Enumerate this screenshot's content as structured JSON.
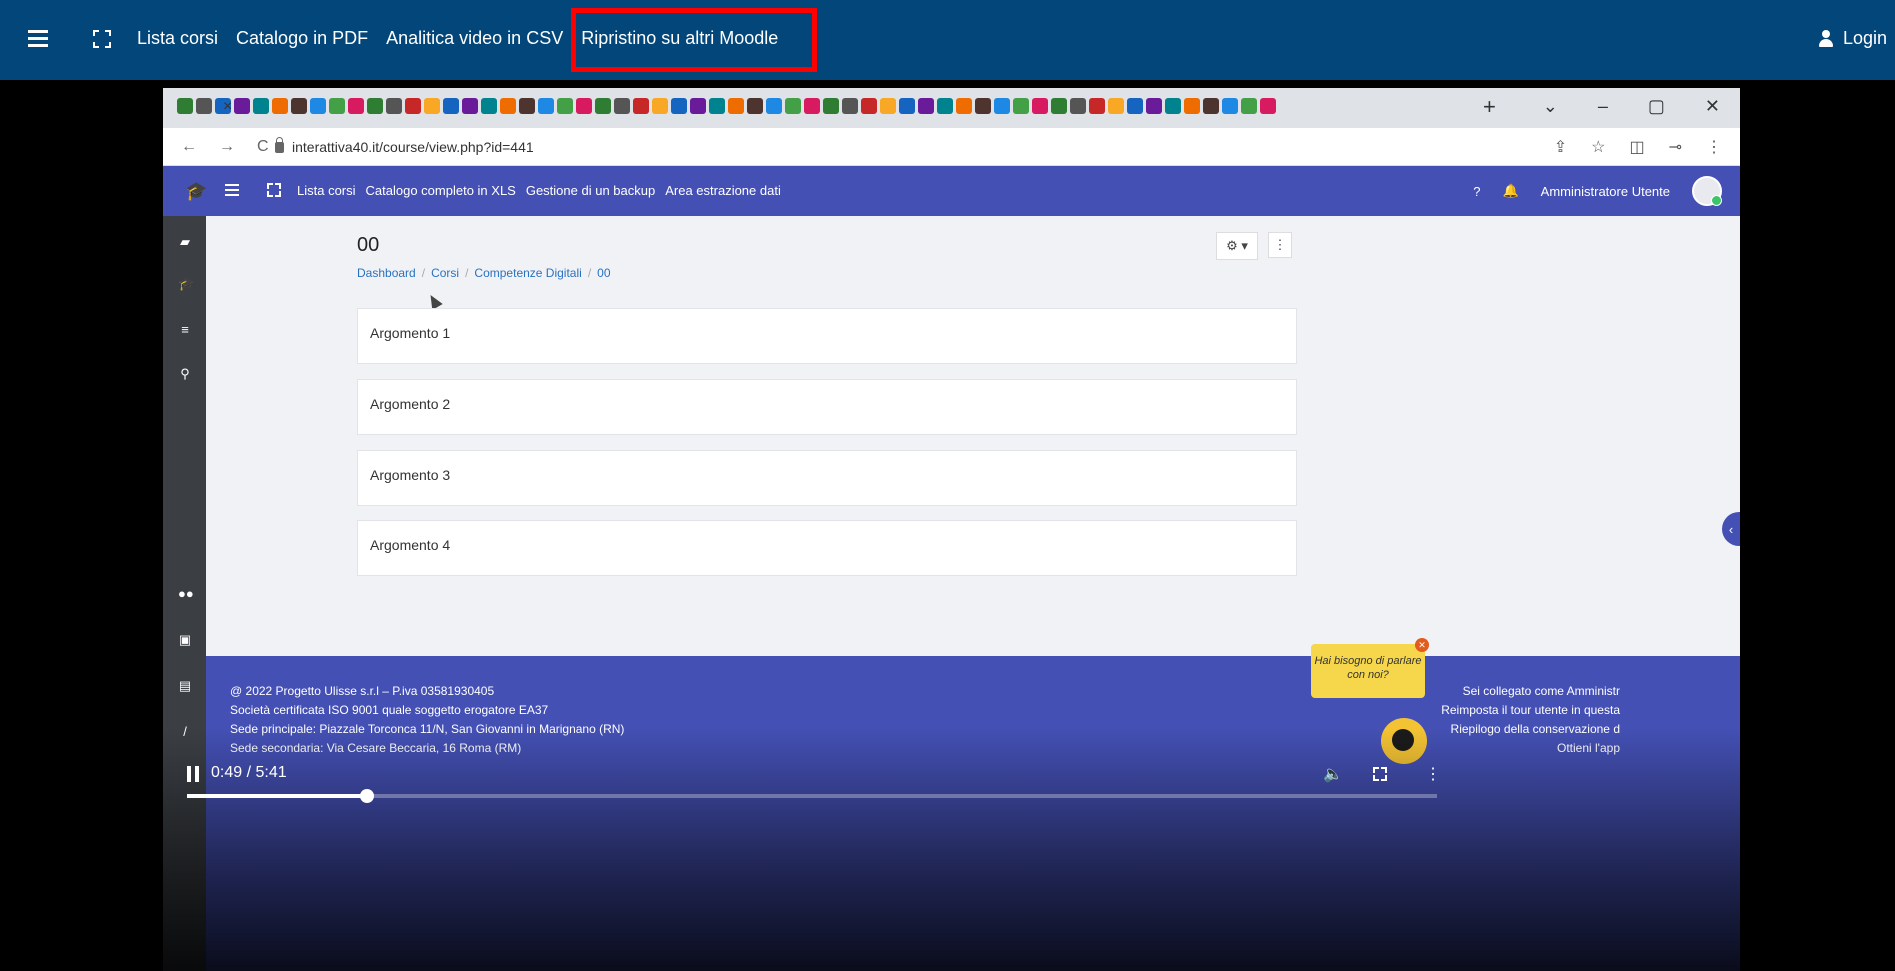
{
  "top_nav": {
    "items": [
      "Lista corsi",
      "Catalogo in PDF",
      "Analitica video in CSV",
      "Ripristino su altri Moodle"
    ],
    "login_label": "Login"
  },
  "browser": {
    "url": "interattiva40.it/course/view.php?id=441",
    "tab_close": "×",
    "new_tab": "+"
  },
  "moodle": {
    "nav_items": [
      "Lista corsi",
      "Catalogo completo in XLS",
      "Gestione di un backup",
      "Area estrazione dati"
    ],
    "user_name": "Amministratore Utente",
    "course_title": "00",
    "breadcrumb": [
      "Dashboard",
      "Corsi",
      "Competenze Digitali",
      "00"
    ],
    "sections": [
      "Argomento 1",
      "Argomento 2",
      "Argomento 3",
      "Argomento 4"
    ],
    "footer_left": [
      "@ 2022 Progetto Ulisse s.r.l – P.iva 03581930405",
      "Società certificata ISO 9001 quale soggetto erogatore EA37",
      "Sede principale: Piazzale Torconca 11/N, San Giovanni in Marignano (RN)",
      "Sede secondaria: Via Cesare Beccaria, 16 Roma (RM)"
    ],
    "footer_right": [
      "Sei collegato come Amministr",
      "Reimposta il tour utente in questa",
      "Riepilogo della conservazione d",
      "Ottieni l'app"
    ],
    "chat_bubble": "Hai bisogno di parlare con noi?"
  },
  "video": {
    "timecode": "0:49 / 5:41",
    "progress_fraction": 0.1441
  },
  "colors": {
    "topbar": "#02467a",
    "moodle_primary": "#4450b4",
    "highlight": "#ff0000",
    "chat": "#f6d64a"
  }
}
